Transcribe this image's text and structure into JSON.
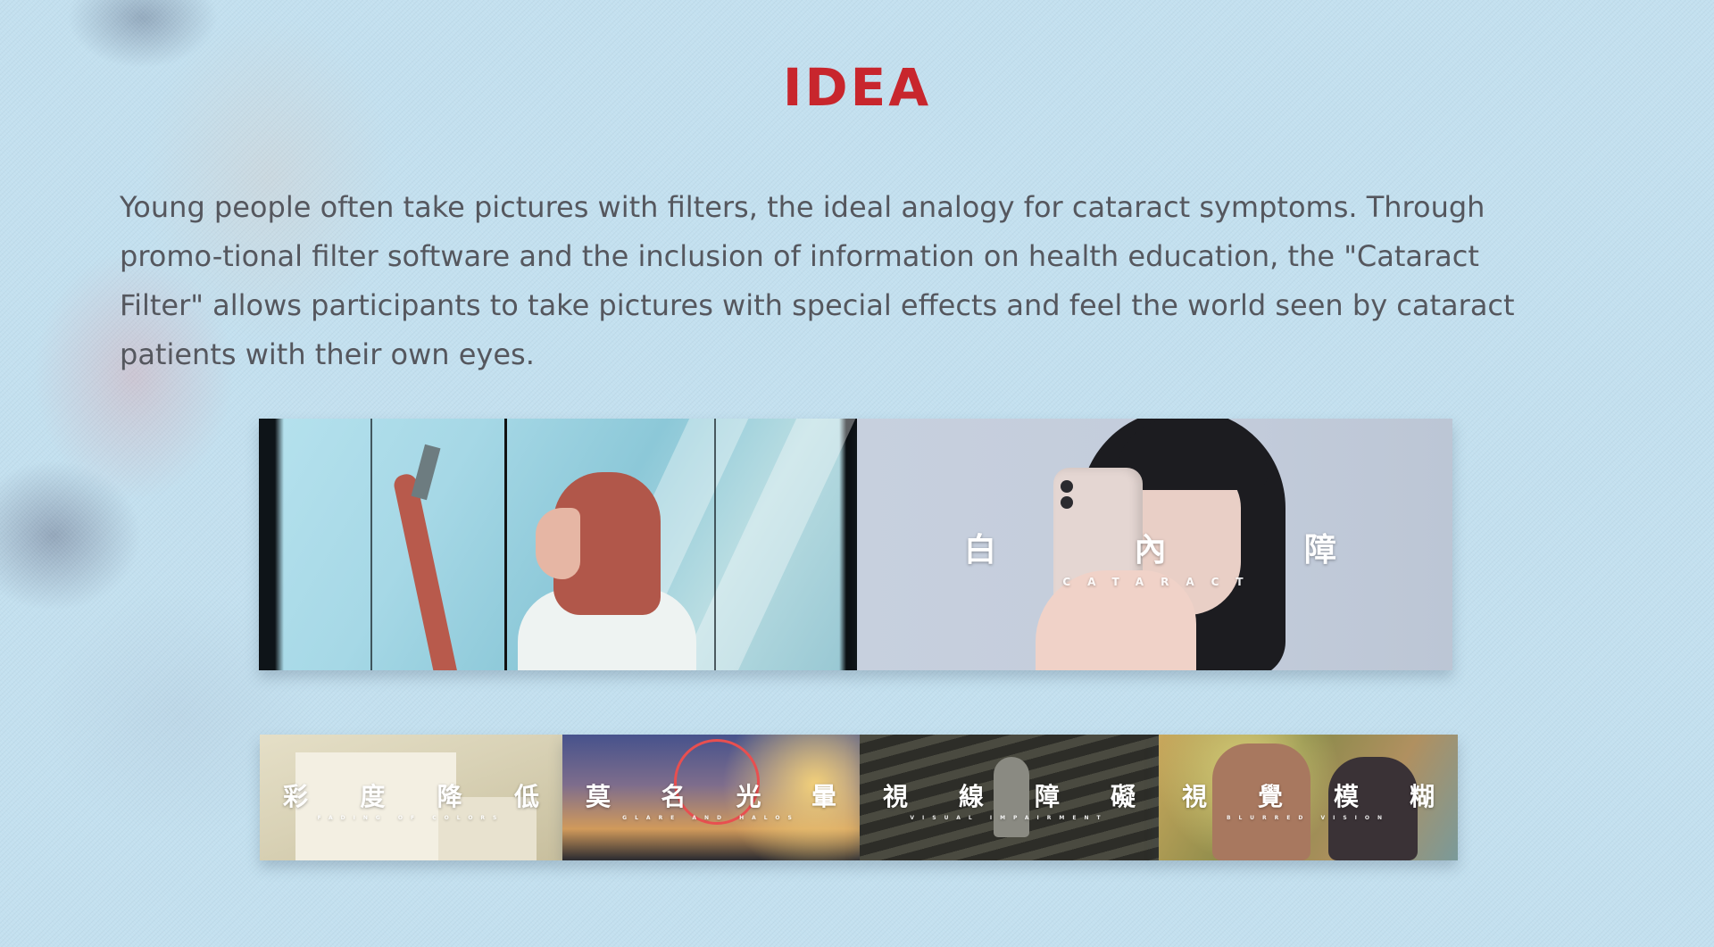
{
  "title": "IDEA",
  "intro": "Young people often take pictures with filters, the ideal analogy for cataract symptoms. Through promo-tional filter software and the inclusion of information on health education, the \"Cataract Filter\" allows participants to take pictures with special effects and feel the world seen by cataract patients with their own eyes.",
  "hero": {
    "overlay_chars": [
      "白",
      "內",
      "障"
    ],
    "overlay_sub": "CATARACT"
  },
  "thumbnails": [
    {
      "chars": [
        "彩",
        "度",
        "降",
        "低"
      ],
      "sub": "FADING OF COLORS"
    },
    {
      "chars": [
        "莫",
        "名",
        "光",
        "暈"
      ],
      "sub": "GLARE AND HALOS"
    },
    {
      "chars": [
        "視",
        "線",
        "障",
        "礙"
      ],
      "sub": "VISUAL IMPAIRMENT"
    },
    {
      "chars": [
        "視",
        "覺",
        "模",
        "糊"
      ],
      "sub": "BLURRED VISION"
    }
  ],
  "colors": {
    "title": "#c8262d",
    "body_text": "#55575e",
    "background": "#c3e0ef"
  }
}
